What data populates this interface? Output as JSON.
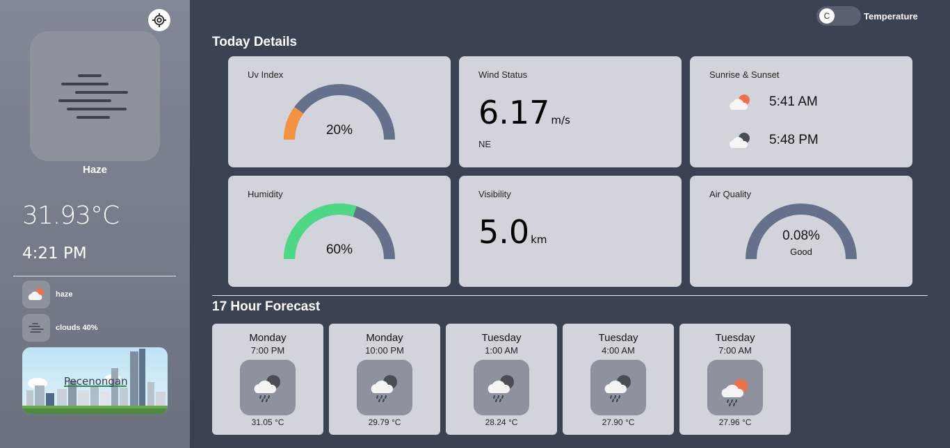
{
  "sidebar": {
    "condition": "Haze",
    "temperature": "31.93°C",
    "time": "4:21 PM",
    "details": [
      {
        "label": "haze",
        "icon": "sun-cloud-icon"
      },
      {
        "label": "clouds 40%",
        "icon": "haze-icon"
      }
    ],
    "city": "Pecenongan"
  },
  "toggle": {
    "knob": "C",
    "label": "Temperature"
  },
  "today": {
    "heading": "Today Details",
    "uv": {
      "title": "Uv Index",
      "value": "20%",
      "fraction": 0.2
    },
    "wind": {
      "title": "Wind Status",
      "value": "6.17",
      "unit": "m/s",
      "direction": "NE"
    },
    "sun": {
      "title": "Sunrise & Sunset",
      "sunrise": "5:41 AM",
      "sunset": "5:48 PM"
    },
    "humidity": {
      "title": "Humidity",
      "value": "60%",
      "fraction": 0.6
    },
    "visibility": {
      "title": "Visibility",
      "value": "5.0",
      "unit": "km"
    },
    "air": {
      "title": "Air Quality",
      "value": "0.08%",
      "status": "Good"
    }
  },
  "forecast": {
    "heading": "17 Hour Forecast",
    "items": [
      {
        "day": "Monday",
        "time": "7:00 PM",
        "temp": "31.05 °C",
        "icon": "night-rain-icon"
      },
      {
        "day": "Monday",
        "time": "10:00 PM",
        "temp": "29.79 °C",
        "icon": "night-rain-icon"
      },
      {
        "day": "Tuesday",
        "time": "1:00 AM",
        "temp": "28.24 °C",
        "icon": "night-rain-icon"
      },
      {
        "day": "Tuesday",
        "time": "4:00 AM",
        "temp": "27.90 °C",
        "icon": "night-rain-icon"
      },
      {
        "day": "Tuesday",
        "time": "7:00 AM",
        "temp": "27.96 °C",
        "icon": "day-rain-icon"
      }
    ]
  },
  "colors": {
    "uv": "#f5923e",
    "humidity": "#4cd884",
    "gauge_track": "#65718a",
    "sun": "#f0704a",
    "moon": "#4a4d55"
  }
}
